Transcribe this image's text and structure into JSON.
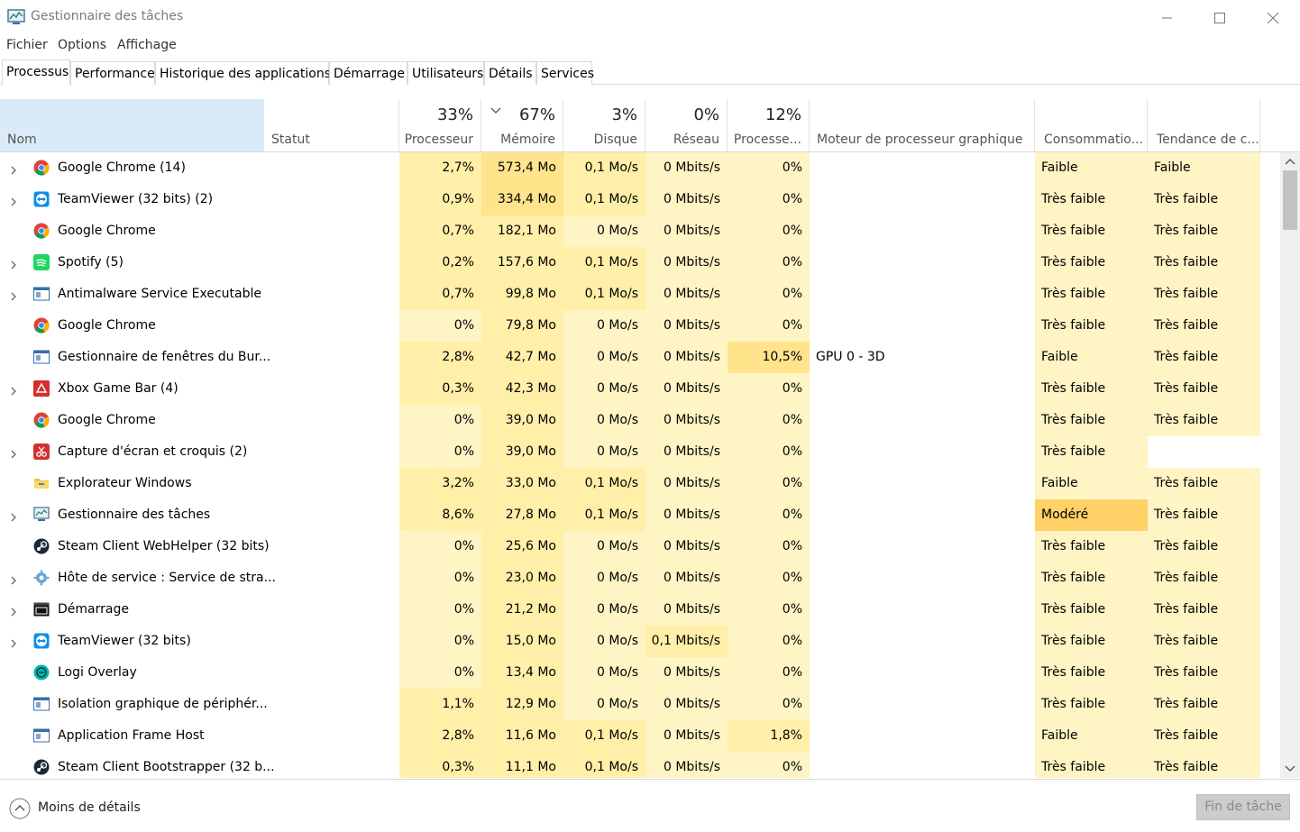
{
  "window": {
    "title": "Gestionnaire des tâches"
  },
  "menu": [
    "Fichier",
    "Options",
    "Affichage"
  ],
  "tabs": [
    "Processus",
    "Performance",
    "Historique des applications",
    "Démarrage",
    "Utilisateurs",
    "Détails",
    "Services"
  ],
  "active_tab": "Processus",
  "columns": {
    "name": "Nom",
    "status": "Statut",
    "cpu": {
      "percent": "33%",
      "label": "Processeur"
    },
    "memory": {
      "percent": "67%",
      "label": "Mémoire"
    },
    "disk": {
      "percent": "3%",
      "label": "Disque"
    },
    "network": {
      "percent": "0%",
      "label": "Réseau"
    },
    "gpu": {
      "percent": "12%",
      "label": "Processe..."
    },
    "gpu_engine": "Moteur de processeur graphique",
    "power": "Consommatio...",
    "power_trend": "Tendance de c..."
  },
  "processes": [
    {
      "name": "Google Chrome (14)",
      "icon": "chrome-icon",
      "expandable": true,
      "cpu": "2,7%",
      "mem": "573,4 Mo",
      "disk": "0,1 Mo/s",
      "net": "0 Mbits/s",
      "gpu": "0%",
      "engine": "",
      "power": "Faible",
      "trend": "Faible"
    },
    {
      "name": "TeamViewer (32 bits) (2)",
      "icon": "teamviewer-icon",
      "expandable": true,
      "cpu": "0,9%",
      "mem": "334,4 Mo",
      "disk": "0,1 Mo/s",
      "net": "0 Mbits/s",
      "gpu": "0%",
      "engine": "",
      "power": "Très faible",
      "trend": "Très faible"
    },
    {
      "name": "Google Chrome",
      "icon": "chrome-icon",
      "expandable": false,
      "cpu": "0,7%",
      "mem": "182,1 Mo",
      "disk": "0 Mo/s",
      "net": "0 Mbits/s",
      "gpu": "0%",
      "engine": "",
      "power": "Très faible",
      "trend": "Très faible"
    },
    {
      "name": "Spotify (5)",
      "icon": "spotify-icon",
      "expandable": true,
      "cpu": "0,2%",
      "mem": "157,6 Mo",
      "disk": "0,1 Mo/s",
      "net": "0 Mbits/s",
      "gpu": "0%",
      "engine": "",
      "power": "Très faible",
      "trend": "Très faible"
    },
    {
      "name": "Antimalware Service Executable",
      "icon": "window-app-icon",
      "expandable": true,
      "cpu": "0,7%",
      "mem": "99,8 Mo",
      "disk": "0,1 Mo/s",
      "net": "0 Mbits/s",
      "gpu": "0%",
      "engine": "",
      "power": "Très faible",
      "trend": "Très faible"
    },
    {
      "name": "Google Chrome",
      "icon": "chrome-icon",
      "expandable": false,
      "cpu": "0%",
      "mem": "79,8 Mo",
      "disk": "0 Mo/s",
      "net": "0 Mbits/s",
      "gpu": "0%",
      "engine": "",
      "power": "Très faible",
      "trend": "Très faible"
    },
    {
      "name": "Gestionnaire de fenêtres du Bur...",
      "icon": "window-app-icon",
      "expandable": false,
      "cpu": "2,8%",
      "mem": "42,7 Mo",
      "disk": "0 Mo/s",
      "net": "0 Mbits/s",
      "gpu": "10,5%",
      "engine": "GPU 0 - 3D",
      "power": "Faible",
      "trend": "Très faible"
    },
    {
      "name": "Xbox Game Bar (4)",
      "icon": "xbox-game-bar-icon",
      "expandable": true,
      "cpu": "0,3%",
      "mem": "42,3 Mo",
      "disk": "0 Mo/s",
      "net": "0 Mbits/s",
      "gpu": "0%",
      "engine": "",
      "power": "Très faible",
      "trend": "Très faible"
    },
    {
      "name": "Google Chrome",
      "icon": "chrome-icon",
      "expandable": false,
      "cpu": "0%",
      "mem": "39,0 Mo",
      "disk": "0 Mo/s",
      "net": "0 Mbits/s",
      "gpu": "0%",
      "engine": "",
      "power": "Très faible",
      "trend": "Très faible"
    },
    {
      "name": "Capture d'écran et croquis (2)",
      "icon": "snip-sketch-icon",
      "expandable": true,
      "cpu": "0%",
      "mem": "39,0 Mo",
      "disk": "0 Mo/s",
      "net": "0 Mbits/s",
      "gpu": "0%",
      "engine": "",
      "power": "Très faible",
      "trend": ""
    },
    {
      "name": "Explorateur Windows",
      "icon": "folder-icon",
      "expandable": false,
      "cpu": "3,2%",
      "mem": "33,0 Mo",
      "disk": "0,1 Mo/s",
      "net": "0 Mbits/s",
      "gpu": "0%",
      "engine": "",
      "power": "Faible",
      "trend": "Très faible"
    },
    {
      "name": "Gestionnaire des tâches",
      "icon": "task-manager-icon",
      "expandable": true,
      "cpu": "8,6%",
      "mem": "27,8 Mo",
      "disk": "0,1 Mo/s",
      "net": "0 Mbits/s",
      "gpu": "0%",
      "engine": "",
      "power": "Modéré",
      "trend": "Très faible"
    },
    {
      "name": "Steam Client WebHelper (32 bits)",
      "icon": "steam-icon",
      "expandable": false,
      "cpu": "0%",
      "mem": "25,6 Mo",
      "disk": "0 Mo/s",
      "net": "0 Mbits/s",
      "gpu": "0%",
      "engine": "",
      "power": "Très faible",
      "trend": "Très faible"
    },
    {
      "name": "Hôte de service : Service de stra...",
      "icon": "gear-icon",
      "expandable": true,
      "cpu": "0%",
      "mem": "23,0 Mo",
      "disk": "0 Mo/s",
      "net": "0 Mbits/s",
      "gpu": "0%",
      "engine": "",
      "power": "Très faible",
      "trend": "Très faible"
    },
    {
      "name": "Démarrage",
      "icon": "console-icon",
      "expandable": true,
      "cpu": "0%",
      "mem": "21,2 Mo",
      "disk": "0 Mo/s",
      "net": "0 Mbits/s",
      "gpu": "0%",
      "engine": "",
      "power": "Très faible",
      "trend": "Très faible"
    },
    {
      "name": "TeamViewer (32 bits)",
      "icon": "teamviewer-icon",
      "expandable": true,
      "cpu": "0%",
      "mem": "15,0 Mo",
      "disk": "0 Mo/s",
      "net": "0,1 Mbits/s",
      "gpu": "0%",
      "engine": "",
      "power": "Très faible",
      "trend": "Très faible"
    },
    {
      "name": "Logi Overlay",
      "icon": "logi-icon",
      "expandable": false,
      "cpu": "0%",
      "mem": "13,4 Mo",
      "disk": "0 Mo/s",
      "net": "0 Mbits/s",
      "gpu": "0%",
      "engine": "",
      "power": "Très faible",
      "trend": "Très faible"
    },
    {
      "name": "Isolation graphique de périphér...",
      "icon": "window-app-icon",
      "expandable": false,
      "cpu": "1,1%",
      "mem": "12,9 Mo",
      "disk": "0 Mo/s",
      "net": "0 Mbits/s",
      "gpu": "0%",
      "engine": "",
      "power": "Très faible",
      "trend": "Très faible"
    },
    {
      "name": "Application Frame Host",
      "icon": "window-app-icon",
      "expandable": false,
      "cpu": "2,8%",
      "mem": "11,6 Mo",
      "disk": "0,1 Mo/s",
      "net": "0 Mbits/s",
      "gpu": "1,8%",
      "engine": "",
      "power": "Faible",
      "trend": "Très faible"
    },
    {
      "name": "Steam Client Bootstrapper (32 b...",
      "icon": "steam-icon",
      "expandable": false,
      "cpu": "0,3%",
      "mem": "11,1 Mo",
      "disk": "0,1 Mo/s",
      "net": "0 Mbits/s",
      "gpu": "0%",
      "engine": "",
      "power": "Très faible",
      "trend": "Très faible"
    }
  ],
  "footer": {
    "less_details": "Moins de détails",
    "end_task": "Fin de tâche"
  },
  "colors": {
    "heat_low": "#fff4c4",
    "heat_mid": "#ffefa8",
    "heat_high": "#ffe48c",
    "heat_moderate": "#ffd166",
    "name_header": "#d9ebf9"
  }
}
